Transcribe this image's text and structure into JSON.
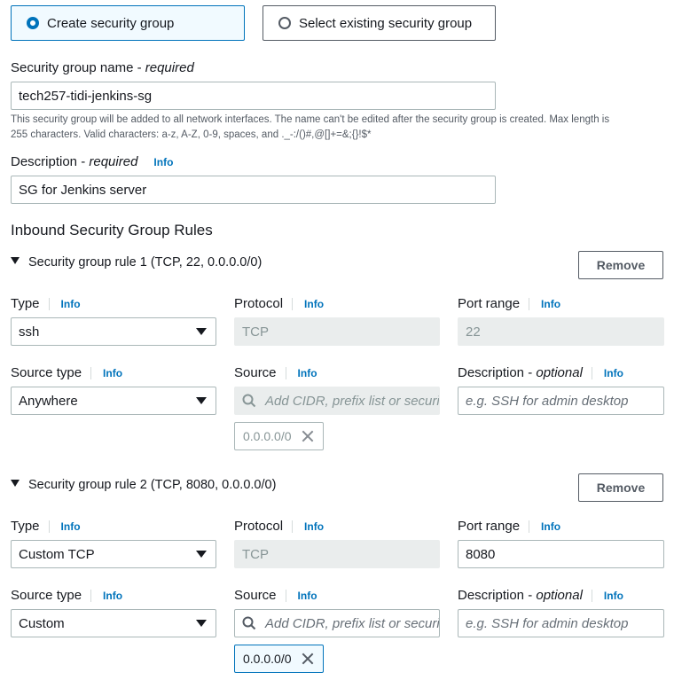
{
  "security_group_choice": {
    "create_label": "Create security group",
    "select_existing_label": "Select existing security group"
  },
  "name_field": {
    "label": "Security group name",
    "label_suffix": "required",
    "value": "tech257-tidi-jenkins-sg",
    "help_line1": "This security group will be added to all network interfaces. The name can't be edited after the security group is created. Max length is",
    "help_line2": "255 characters. Valid characters: a-z, A-Z, 0-9, spaces, and ._-:/()#,@[]+=&;{}!$*"
  },
  "description_field": {
    "label": "Description",
    "label_suffix": "required",
    "info": "Info",
    "value": "SG for Jenkins server"
  },
  "inbound_heading": "Inbound Security Group Rules",
  "labels": {
    "type": "Type",
    "protocol": "Protocol",
    "port_range": "Port range",
    "source_type": "Source type",
    "source": "Source",
    "description": "Description",
    "optional": "optional",
    "info": "Info",
    "remove": "Remove",
    "source_placeholder": "Add CIDR, prefix list or security",
    "description_placeholder": "e.g. SSH for admin desktop"
  },
  "rules": [
    {
      "title": "Security group rule 1 (TCP, 22, 0.0.0.0/0)",
      "type": "ssh",
      "protocol": "TCP",
      "port_range": "22",
      "source_type": "Anywhere",
      "token": "0.0.0.0/0"
    },
    {
      "title": "Security group rule 2 (TCP, 8080, 0.0.0.0/0)",
      "type": "Custom TCP",
      "protocol": "TCP",
      "port_range": "8080",
      "source_type": "Custom",
      "token": "0.0.0.0/0"
    }
  ],
  "colors": {
    "accent": "#0073bb",
    "selected_tile_bg": "#f1faff",
    "disabled_bg": "#eaeded"
  }
}
